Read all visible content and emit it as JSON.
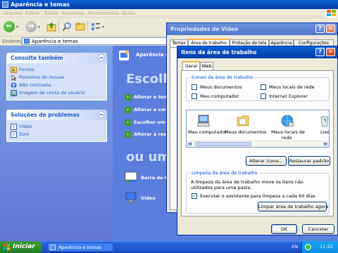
{
  "control_panel": {
    "title": "Aparência e temas",
    "menu": [
      "Arquivo",
      "Editar",
      "Exibir",
      "Favoritos",
      "Ferramentas",
      "Ajuda"
    ],
    "address_label": "Endereço",
    "address_value": "Aparência e temas",
    "see_also": {
      "title": "Consulte também",
      "links": [
        "Fontes",
        "Ponteiros do mouse",
        "Alto contraste",
        "Imagem de conta do usuário"
      ]
    },
    "troubleshoot": {
      "title": "Soluções de problemas",
      "links": [
        "Vídeo",
        "Som"
      ]
    },
    "header_text": "Aparência e temas",
    "heading_task": "Escolha",
    "tasks": [
      "Alterar o tema",
      "Alterar a cor d",
      "Escolher um p",
      "Alterar a reso"
    ],
    "heading_icon": "ou um í",
    "icons": [
      "Barra de ta",
      "Vídeo"
    ]
  },
  "display_properties": {
    "title": "Propriedades de Vídeo",
    "tabs": [
      "Temas",
      "Área de trabalho",
      "Proteção de tela",
      "Aparência",
      "Configurações"
    ]
  },
  "desktop_items": {
    "title": "Itens da área de trabalho",
    "tabs": [
      "Geral",
      "Web"
    ],
    "icons_group_title": "Ícones da área de trabalho",
    "checkboxes": [
      {
        "label": "Meus documentos",
        "checked": false
      },
      {
        "label": "Meus locais de rede",
        "checked": false
      },
      {
        "label": "Meu computador",
        "checked": false
      },
      {
        "label": "Internet Explorer",
        "checked": false
      }
    ],
    "desktop_icons": [
      "Meu computador",
      "Meus documentos",
      "Meus locais de",
      "rede",
      "Lixeir"
    ],
    "change_icon_button": "Alterar ícone...",
    "restore_default_button": "Restaurar padrão",
    "cleanup_group_title": "Limpeza da área de trabalho",
    "cleanup_text_1": "A limpeza da área de trabalho move os itens não utilizados para",
    "cleanup_text_2": "uma pasta.",
    "cleanup_checkbox": {
      "label": "Executar o assistente para limpeza a cada 60 dias",
      "checked": true
    },
    "clean_now_button": "Limpar área de trabalho agora",
    "ok_button": "OK",
    "cancel_button": "Cancelar"
  },
  "taskbar": {
    "start_label": "Iniciar",
    "task_button": "Aparência e temas",
    "language": "EN",
    "clock": "11:22"
  }
}
